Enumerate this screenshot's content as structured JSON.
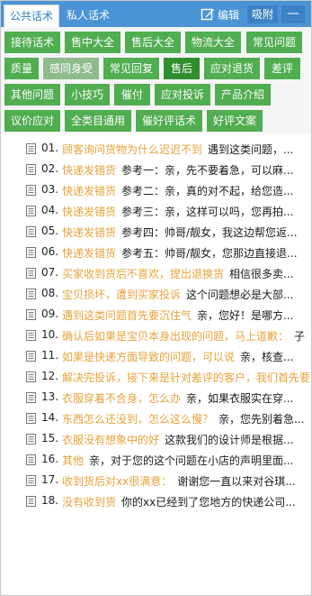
{
  "header": {
    "tabs": [
      {
        "label": "公共话术",
        "active": true
      },
      {
        "label": "私人话术",
        "active": false
      }
    ],
    "edit_label": "编辑",
    "stick_label": "吸附",
    "minimize_label": "—"
  },
  "categories": [
    {
      "label": "接待话术",
      "state": "normal"
    },
    {
      "label": "售中大全",
      "state": "normal"
    },
    {
      "label": "售后大全",
      "state": "normal"
    },
    {
      "label": "物流大全",
      "state": "normal"
    },
    {
      "label": "常见问题",
      "state": "normal"
    },
    {
      "label": "质量",
      "state": "normal"
    },
    {
      "label": "感同身受",
      "state": "light"
    },
    {
      "label": "常见回复",
      "state": "normal"
    },
    {
      "label": "售后",
      "state": "active"
    },
    {
      "label": "应对退货",
      "state": "normal"
    },
    {
      "label": "差评",
      "state": "normal"
    },
    {
      "label": "其他问题",
      "state": "normal"
    },
    {
      "label": "小技巧",
      "state": "normal"
    },
    {
      "label": "催付",
      "state": "normal"
    },
    {
      "label": "应对投诉",
      "state": "normal"
    },
    {
      "label": "产品介绍",
      "state": "normal"
    },
    {
      "label": "议价应对",
      "state": "normal"
    },
    {
      "label": "全类目通用",
      "state": "normal"
    },
    {
      "label": "催好评话术",
      "state": "normal"
    },
    {
      "label": "好评文案",
      "state": "normal"
    }
  ],
  "items": [
    {
      "num": "01.",
      "title": "顾客询问货物为什么迟迟不到",
      "body": "遇到这类问题，..."
    },
    {
      "num": "02.",
      "title": "快递发错货",
      "body": "参考一：亲，先不要着急，可以麻..."
    },
    {
      "num": "03.",
      "title": "快递发错货",
      "body": "参考二：亲，真的对不起，给您造..."
    },
    {
      "num": "04.",
      "title": "快递发错货",
      "body": "参考三：亲，这样可以吗，您再拍..."
    },
    {
      "num": "05.",
      "title": "快递发错货",
      "body": "参考四：帅哥/靓女，我这边帮您返..."
    },
    {
      "num": "06.",
      "title": "快递发错货",
      "body": "参考五：帅哥/靓女，您那边直接退..."
    },
    {
      "num": "07.",
      "title": "买家收到货后不喜欢，提出退换货",
      "body": "相信很多卖..."
    },
    {
      "num": "08.",
      "title": "宝贝损坏，遭到买家投诉",
      "body": "这个问题想必是大部..."
    },
    {
      "num": "09.",
      "title": "遇到这类问题首先要沉住气",
      "body": "亲，您好！是哪方..."
    },
    {
      "num": "10.",
      "title": "确认后如果是宝贝本身出现的问题，马上道歉：",
      "body": "子"
    },
    {
      "num": "11.",
      "title": "如果是快递方面导致的问题，可以说",
      "body": "亲，核查..."
    },
    {
      "num": "12.",
      "title": "解决完投诉，接下来是针对差评的客户，我们首先要",
      "body": ""
    },
    {
      "num": "13.",
      "title": "衣服穿着不合身，怎么办",
      "body": "亲，如果衣服实在穿..."
    },
    {
      "num": "14.",
      "title": "东西怎么还没到，怎么这么慢？",
      "body": "亲，您先别着急..."
    },
    {
      "num": "15.",
      "title": "衣服没有想象中的好",
      "body": "这款我们的设计师是根据..."
    },
    {
      "num": "16.",
      "title": "其他",
      "body": "亲，对于您的这个问题在小店的声明里面..."
    },
    {
      "num": "17.",
      "title": "收到货后对xx很满意：",
      "body": "谢谢您一直以来对谷琪..."
    },
    {
      "num": "18.",
      "title": "没有收到货",
      "body": "你的xx已经到了您地方的快递公司..."
    }
  ]
}
